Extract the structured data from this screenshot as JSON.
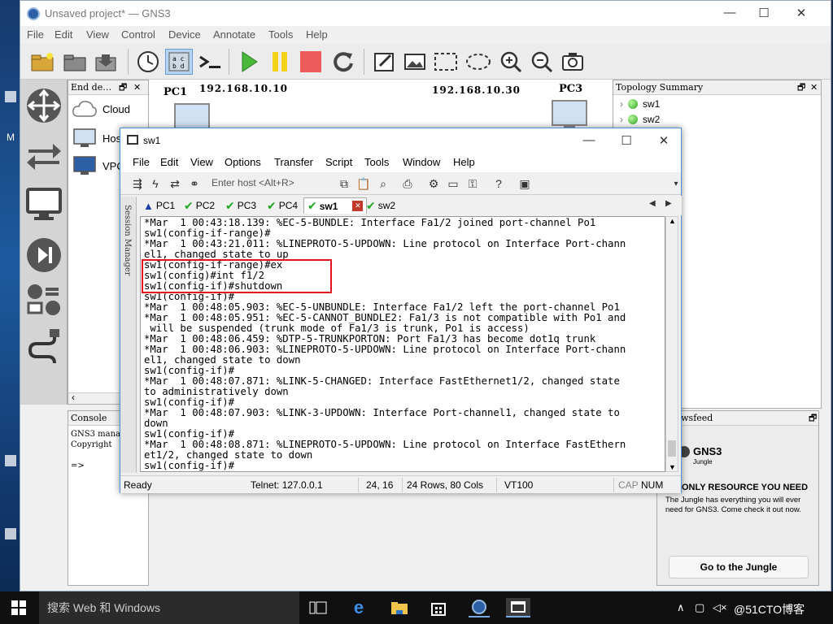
{
  "gns3": {
    "title": "Unsaved project* — GNS3",
    "menu": [
      "File",
      "Edit",
      "View",
      "Control",
      "Device",
      "Annotate",
      "Tools",
      "Help"
    ],
    "end_devices_title": "End de…",
    "end_devices": [
      "Cloud",
      "Hos",
      "VPC"
    ],
    "workspace": {
      "nodes": [
        {
          "label": "PC1"
        },
        {
          "label": "PC3"
        }
      ],
      "ip_labels": [
        "192.168.10.10",
        "192.168.10.30"
      ]
    },
    "topology_summary": {
      "title": "Topology Summary",
      "items": [
        "sw1",
        "sw2"
      ]
    },
    "console": {
      "title": "Console",
      "lines": [
        "GNS3 manag",
        "Copyright",
        "",
        "=>"
      ]
    },
    "newsfeed": {
      "title": "e Newsfeed",
      "brand": "GNS3",
      "brand_sub": "Jungle",
      "headline": "ONLY RESOURCE YOU NEED",
      "body": "The Jungle has everything you will ever need for GNS3. Come check it out now.",
      "button": "Go to the Jungle"
    }
  },
  "crt": {
    "title": "sw1",
    "menu": [
      "File",
      "Edit",
      "View",
      "Options",
      "Transfer",
      "Script",
      "Tools",
      "Window",
      "Help"
    ],
    "host_placeholder": "Enter host <Alt+R>",
    "tabs": [
      {
        "label": "PC1",
        "status": "warning"
      },
      {
        "label": "PC2",
        "status": "ok"
      },
      {
        "label": "PC3",
        "status": "ok"
      },
      {
        "label": "PC4",
        "status": "ok"
      },
      {
        "label": "sw1",
        "status": "ok",
        "active": true
      },
      {
        "label": "sw2",
        "status": "ok"
      }
    ],
    "session_manager": "Session Manager",
    "terminal_lines": [
      "*Mar  1 00:43:18.139: %EC-5-BUNDLE: Interface Fa1/2 joined port-channel Po1",
      "sw1(config-if-range)#",
      "*Mar  1 00:43:21.011: %LINEPROTO-5-UPDOWN: Line protocol on Interface Port-chann",
      "el1, changed state to up",
      "sw1(config-if-range)#ex",
      "sw1(config)#int f1/2",
      "sw1(config-if)#shutdown",
      "sw1(config-if)#",
      "*Mar  1 00:48:05.903: %EC-5-UNBUNDLE: Interface Fa1/2 left the port-channel Po1",
      "*Mar  1 00:48:05.951: %EC-5-CANNOT_BUNDLE2: Fa1/3 is not compatible with Po1 and",
      " will be suspended (trunk mode of Fa1/3 is trunk, Po1 is access)",
      "*Mar  1 00:48:06.459: %DTP-5-TRUNKPORTON: Port Fa1/3 has become dot1q trunk",
      "*Mar  1 00:48:06.903: %LINEPROTO-5-UPDOWN: Line protocol on Interface Port-chann",
      "el1, changed state to down",
      "sw1(config-if)#",
      "*Mar  1 00:48:07.871: %LINK-5-CHANGED: Interface FastEthernet1/2, changed state",
      "to administratively down",
      "sw1(config-if)#",
      "*Mar  1 00:48:07.903: %LINK-3-UPDOWN: Interface Port-channel1, changed state to",
      "down",
      "sw1(config-if)#",
      "*Mar  1 00:48:08.871: %LINEPROTO-5-UPDOWN: Line protocol on Interface FastEthern",
      "et1/2, changed state to down",
      "sw1(config-if)#"
    ],
    "status": {
      "state": "Ready",
      "connection": "Telnet: 127.0.0.1",
      "cursor": "24,  16",
      "size": "24 Rows, 80 Cols",
      "emulation": "VT100",
      "cap": "CAP",
      "num": "NUM"
    }
  },
  "taskbar": {
    "search_placeholder": "搜索 Web 和 Windows",
    "watermark": "@51CTO博客"
  },
  "colors": {
    "highlight": "#e5121f",
    "ok_green": "#1fa81f",
    "warning_blue": "#1c3ea8"
  }
}
